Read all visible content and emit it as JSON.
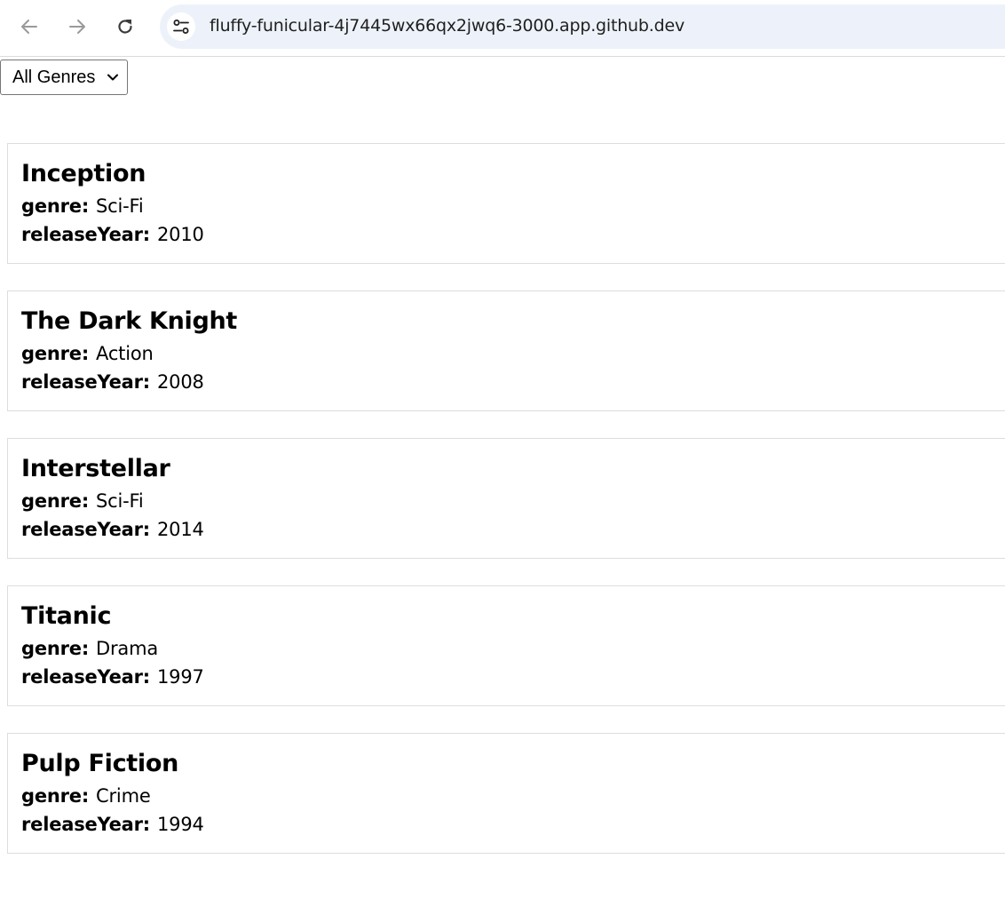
{
  "browser": {
    "url": "fluffy-funicular-4j7445wx66qx2jwq6-3000.app.github.dev",
    "icons": {
      "back": "arrow-left-icon",
      "forward": "arrow-right-icon",
      "reload": "reload-icon",
      "site_info": "tune-icon"
    }
  },
  "filter": {
    "selected": "All Genres"
  },
  "fields": {
    "genre_label": "genre:",
    "year_label": "releaseYear:"
  },
  "movies": [
    {
      "title": "Inception",
      "genre": "Sci-Fi",
      "releaseYear": "2010"
    },
    {
      "title": "The Dark Knight",
      "genre": "Action",
      "releaseYear": "2008"
    },
    {
      "title": "Interstellar",
      "genre": "Sci-Fi",
      "releaseYear": "2014"
    },
    {
      "title": "Titanic",
      "genre": "Drama",
      "releaseYear": "1997"
    },
    {
      "title": "Pulp Fiction",
      "genre": "Crime",
      "releaseYear": "1994"
    }
  ]
}
